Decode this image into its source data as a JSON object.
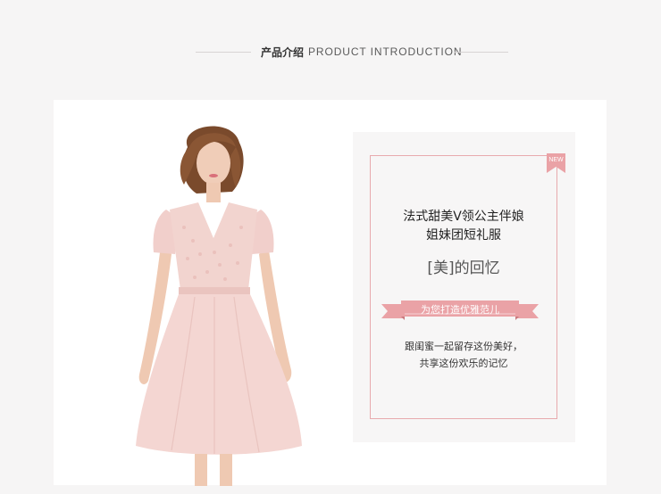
{
  "header": {
    "title_cn": "产品介绍",
    "title_en": "PRODUCT INTRODUCTION"
  },
  "product": {
    "image_name": "pink-lace-dress-model",
    "badge": "NEW",
    "title_line1": "法式甜美V领公主伴娘",
    "title_line2": "姐妹团短礼服",
    "subtitle": "[美]的回忆",
    "ribbon_text": "为您打造优雅范儿",
    "desc_line1": "跟闺蜜一起留存这份美好，",
    "desc_line2": "共享这份欢乐的记忆"
  },
  "colors": {
    "accent": "#e8aaae",
    "ribbon": "#eaa2a6",
    "dress": "#f3d2cf"
  }
}
